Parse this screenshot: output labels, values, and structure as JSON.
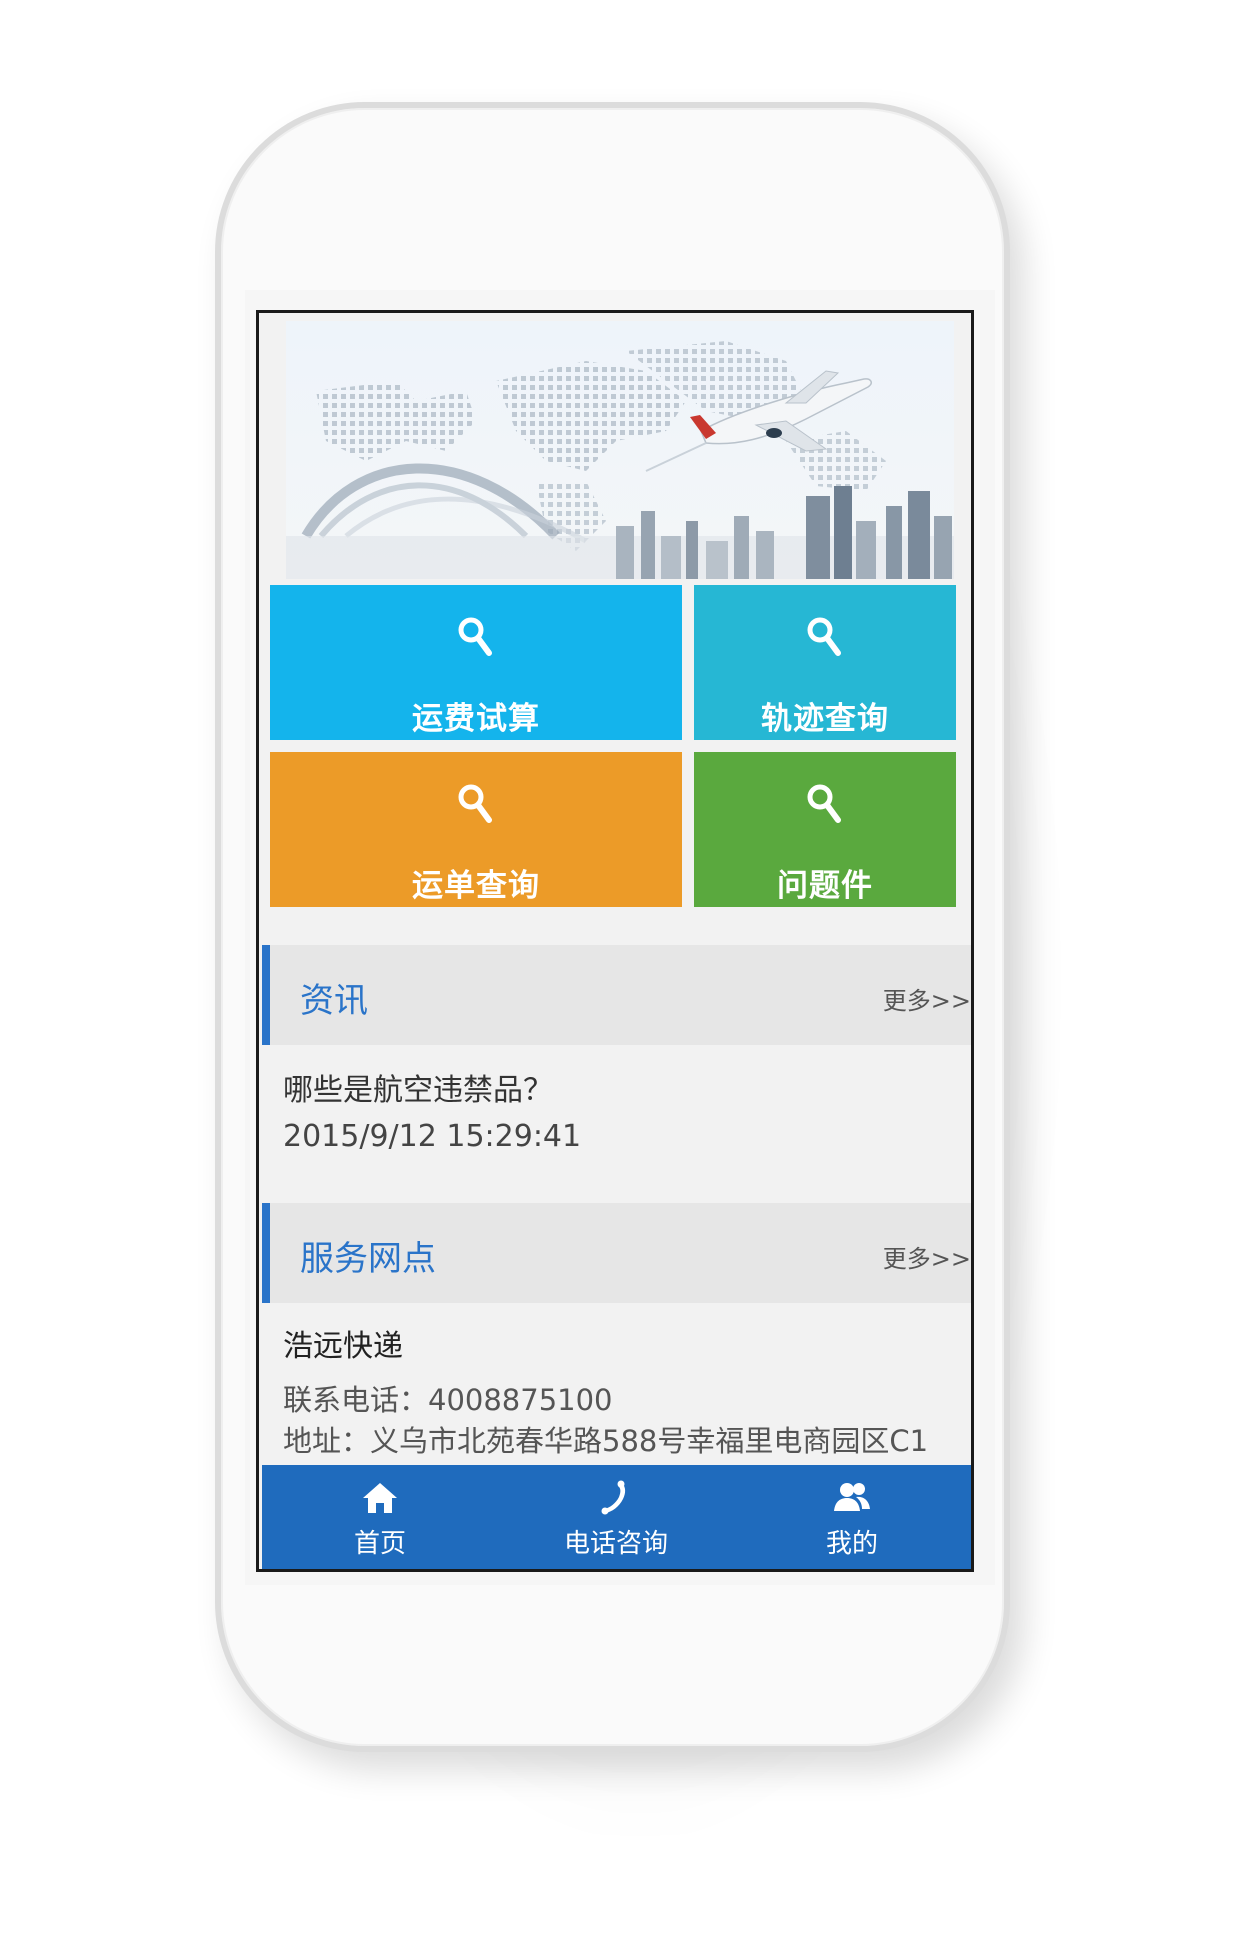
{
  "tiles": {
    "freight_calc": {
      "label": "运费试算",
      "color": "#14b4ec",
      "icon": "search-icon"
    },
    "tracking": {
      "label": "轨迹查询",
      "color": "#26b7d4",
      "icon": "search-icon"
    },
    "waybill": {
      "label": "运单查询",
      "color": "#ec9b28",
      "icon": "search-icon"
    },
    "problem": {
      "label": "问题件",
      "color": "#5aa93e",
      "icon": "search-icon"
    }
  },
  "news": {
    "title": "资讯",
    "more": "更多>>",
    "item_title": "哪些是航空违禁品？",
    "item_time": "2015/9/12 15:29:41"
  },
  "outlets": {
    "title": "服务网点",
    "more": "更多>>",
    "name": "浩远快递",
    "phone": "联系电话：4008875100",
    "address": "地址：义乌市北苑春华路588号幸福里电商园区C1"
  },
  "tabbar": {
    "home": "首页",
    "phone": "电话咨询",
    "mine": "我的",
    "color": "#1f6bbd"
  }
}
